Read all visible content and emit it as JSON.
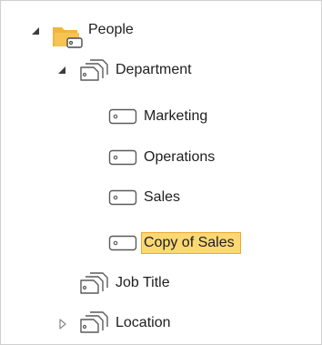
{
  "tree": {
    "people": {
      "label": "People",
      "expanded": true,
      "icon": "folder-icon"
    },
    "department": {
      "label": "Department",
      "expanded": true,
      "icon": "hierarchy-icon"
    },
    "department_items": [
      {
        "label": "Marketing",
        "icon": "tag-icon",
        "selected": false
      },
      {
        "label": "Operations",
        "icon": "tag-icon",
        "selected": false
      },
      {
        "label": "Sales",
        "icon": "tag-icon",
        "selected": false
      },
      {
        "label": "Copy of Sales",
        "icon": "tag-icon",
        "selected": true
      }
    ],
    "job_title": {
      "label": "Job Title",
      "icon": "hierarchy-icon"
    },
    "location": {
      "label": "Location",
      "expanded": false,
      "icon": "hierarchy-icon"
    }
  },
  "colors": {
    "selection_fill": "#fbd874",
    "selection_border": "#f0a830",
    "folder_tab": "#f2b53b",
    "folder_body": "#f6c453",
    "icon_stroke": "#5a5a5a"
  }
}
